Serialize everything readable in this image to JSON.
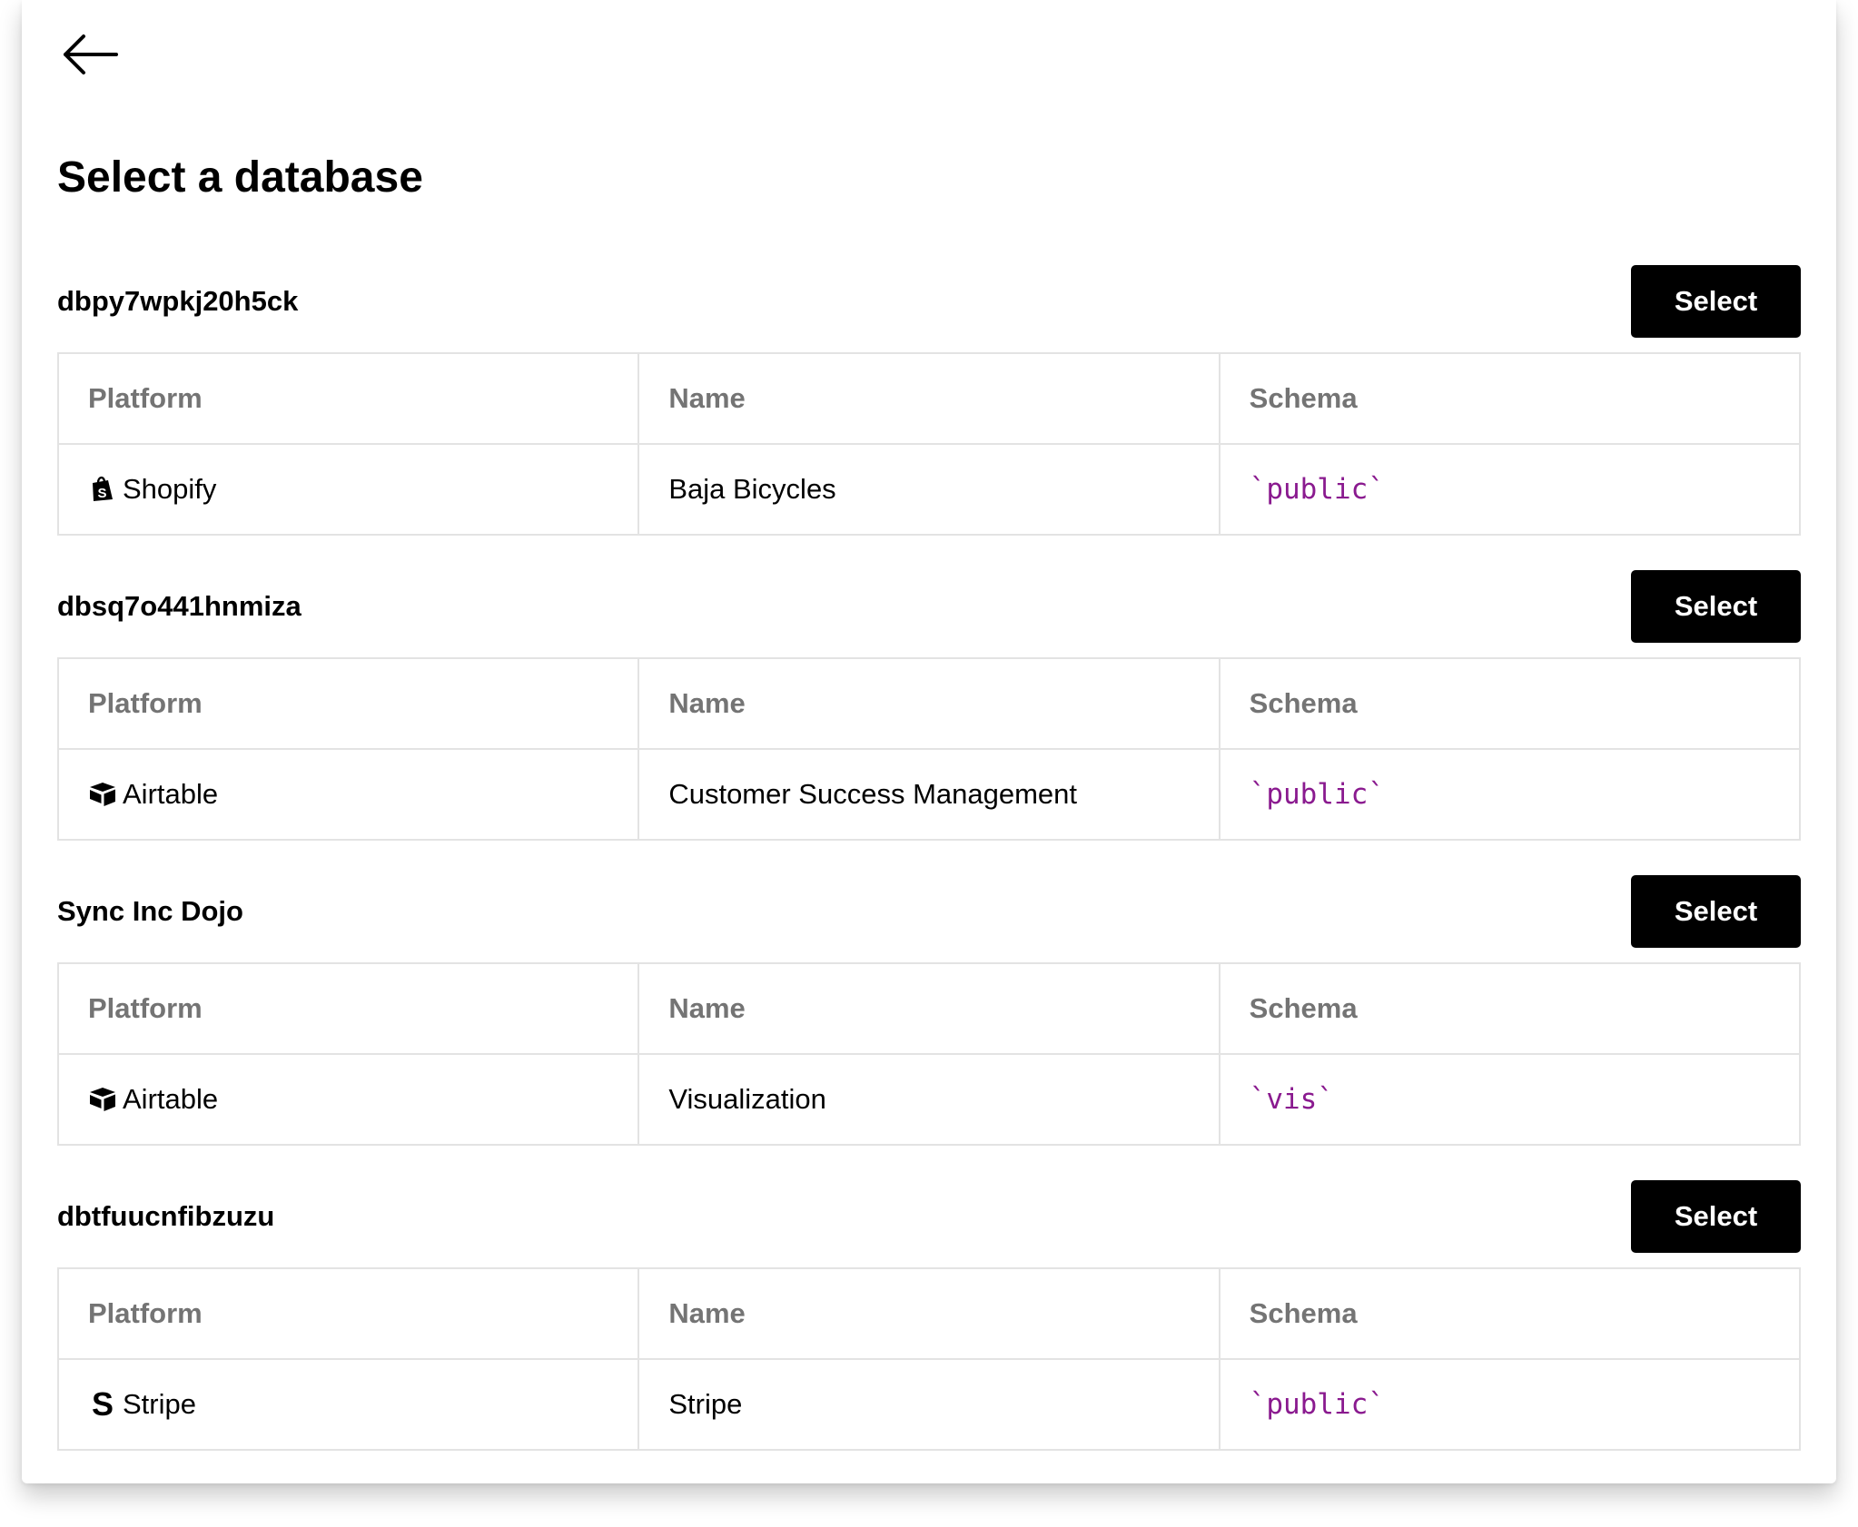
{
  "page": {
    "title": "Select a database"
  },
  "columns": {
    "platform": "Platform",
    "name": "Name",
    "schema": "Schema"
  },
  "databases": [
    {
      "id": "dbpy7wpkj20h5ck",
      "select_label": "Select",
      "platform": "Shopify",
      "platform_icon": "shopify-icon",
      "name": "Baja Bicycles",
      "schema": "`public`"
    },
    {
      "id": "dbsq7o441hnmiza",
      "select_label": "Select",
      "platform": "Airtable",
      "platform_icon": "airtable-icon",
      "name": "Customer Success Management",
      "schema": "`public`"
    },
    {
      "id": "Sync Inc Dojo",
      "select_label": "Select",
      "platform": "Airtable",
      "platform_icon": "airtable-icon",
      "name": "Visualization",
      "schema": "`vis`"
    },
    {
      "id": "dbtfuucnfibzuzu",
      "select_label": "Select",
      "platform": "Stripe",
      "platform_icon": "stripe-icon",
      "name": "Stripe",
      "schema": "`public`"
    }
  ],
  "colors": {
    "button_bg": "#000000",
    "header_text": "#747474",
    "schema_text": "#8a1a8f",
    "border": "#e3e3e3"
  }
}
